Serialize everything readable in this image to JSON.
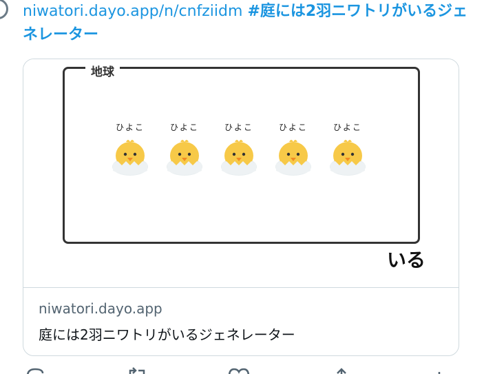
{
  "tweet": {
    "link_text": "niwatori.dayo.app/n/cnfziidm",
    "hashtag_text": "#庭には2羽ニワトリがいるジェネレーター"
  },
  "card": {
    "image": {
      "box_label": "地球",
      "chicks": [
        {
          "label": "ひよこ",
          "icon": "chick-icon"
        },
        {
          "label": "ひよこ",
          "icon": "chick-icon"
        },
        {
          "label": "ひよこ",
          "icon": "chick-icon"
        },
        {
          "label": "ひよこ",
          "icon": "chick-icon"
        },
        {
          "label": "ひよこ",
          "icon": "chick-icon"
        }
      ],
      "suffix": "いる"
    },
    "domain": "niwatori.dayo.app",
    "title": "庭には2羽ニワトリがいるジェネレーター"
  },
  "actions": [
    {
      "icon": "reply-icon"
    },
    {
      "icon": "retweet-icon"
    },
    {
      "icon": "like-icon"
    },
    {
      "icon": "share-icon"
    }
  ]
}
